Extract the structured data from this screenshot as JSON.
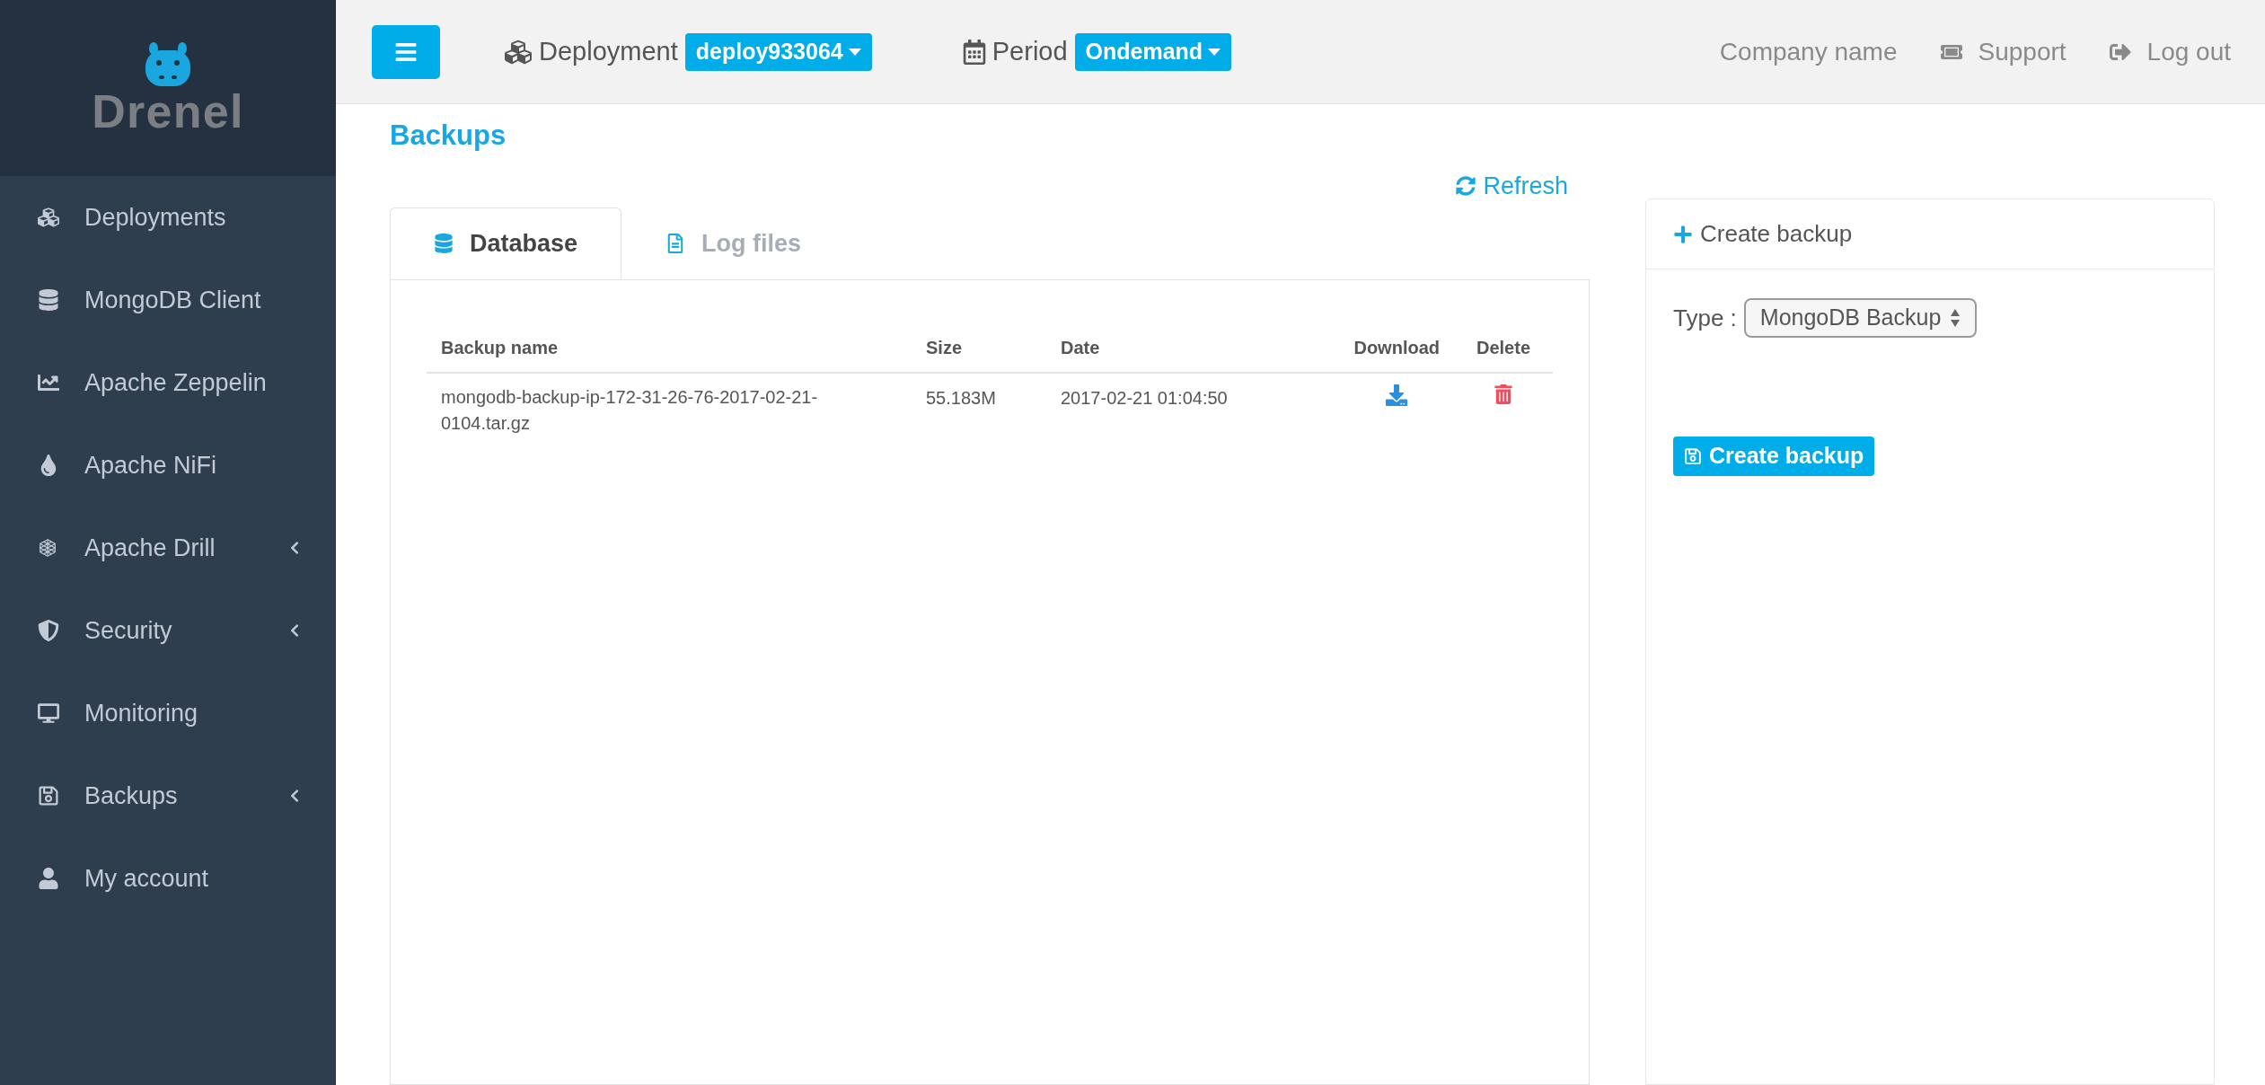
{
  "logo": {
    "text": "Drenel"
  },
  "sidebar": {
    "items": [
      {
        "label": "Deployments",
        "expandable": false
      },
      {
        "label": "MongoDB Client",
        "expandable": false
      },
      {
        "label": "Apache Zeppelin",
        "expandable": false
      },
      {
        "label": "Apache NiFi",
        "expandable": false
      },
      {
        "label": "Apache Drill",
        "expandable": true
      },
      {
        "label": "Security",
        "expandable": true
      },
      {
        "label": "Monitoring",
        "expandable": false
      },
      {
        "label": "Backups",
        "expandable": true
      },
      {
        "label": "My account",
        "expandable": false
      }
    ]
  },
  "header": {
    "deployment": {
      "label": "Deployment",
      "value": "deploy933064"
    },
    "period": {
      "label": "Period",
      "value": "Ondemand"
    },
    "links": [
      "Company name",
      "Support",
      "Log out"
    ]
  },
  "page": {
    "title": "Backups",
    "refresh": "Refresh",
    "tabs": [
      {
        "label": "Database",
        "selected": true
      },
      {
        "label": "Log files",
        "selected": false
      }
    ],
    "table": {
      "columns": [
        "Backup name",
        "Size",
        "Date",
        "Download",
        "Delete"
      ],
      "rows": [
        {
          "name": "mongodb-backup-ip-172-31-26-76-2017-02-21-0104.tar.gz",
          "size": "55.183M",
          "date": "2017-02-21 01:04:50"
        }
      ]
    }
  },
  "create_panel": {
    "title": "Create backup",
    "type_label": "Type :",
    "type_value": "MongoDB Backup",
    "button": "Create backup"
  }
}
